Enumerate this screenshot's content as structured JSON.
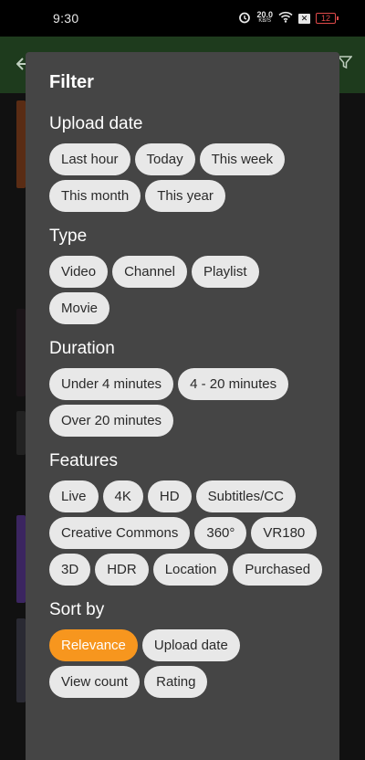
{
  "status_bar": {
    "time": "9:30",
    "net_speed_value": "20.0",
    "net_speed_unit": "KB/S",
    "battery": "12"
  },
  "dialog": {
    "title": "Filter",
    "sections": {
      "upload_date": {
        "title": "Upload date",
        "options": [
          "Last hour",
          "Today",
          "This week",
          "This month",
          "This year"
        ]
      },
      "type": {
        "title": "Type",
        "options": [
          "Video",
          "Channel",
          "Playlist",
          "Movie"
        ]
      },
      "duration": {
        "title": "Duration",
        "options": [
          "Under 4 minutes",
          "4 - 20 minutes",
          "Over 20 minutes"
        ]
      },
      "features": {
        "title": "Features",
        "options": [
          "Live",
          "4K",
          "HD",
          "Subtitles/CC",
          "Creative Commons",
          "360°",
          "VR180",
          "3D",
          "HDR",
          "Location",
          "Purchased"
        ]
      },
      "sort_by": {
        "title": "Sort by",
        "options": [
          "Relevance",
          "Upload date",
          "View count",
          "Rating"
        ],
        "selected": "Relevance"
      }
    }
  },
  "colors": {
    "dialog_bg": "#454545",
    "chip_bg": "#e8e8e8",
    "chip_selected": "#f7961e",
    "app_bar": "#1e3b1d"
  }
}
